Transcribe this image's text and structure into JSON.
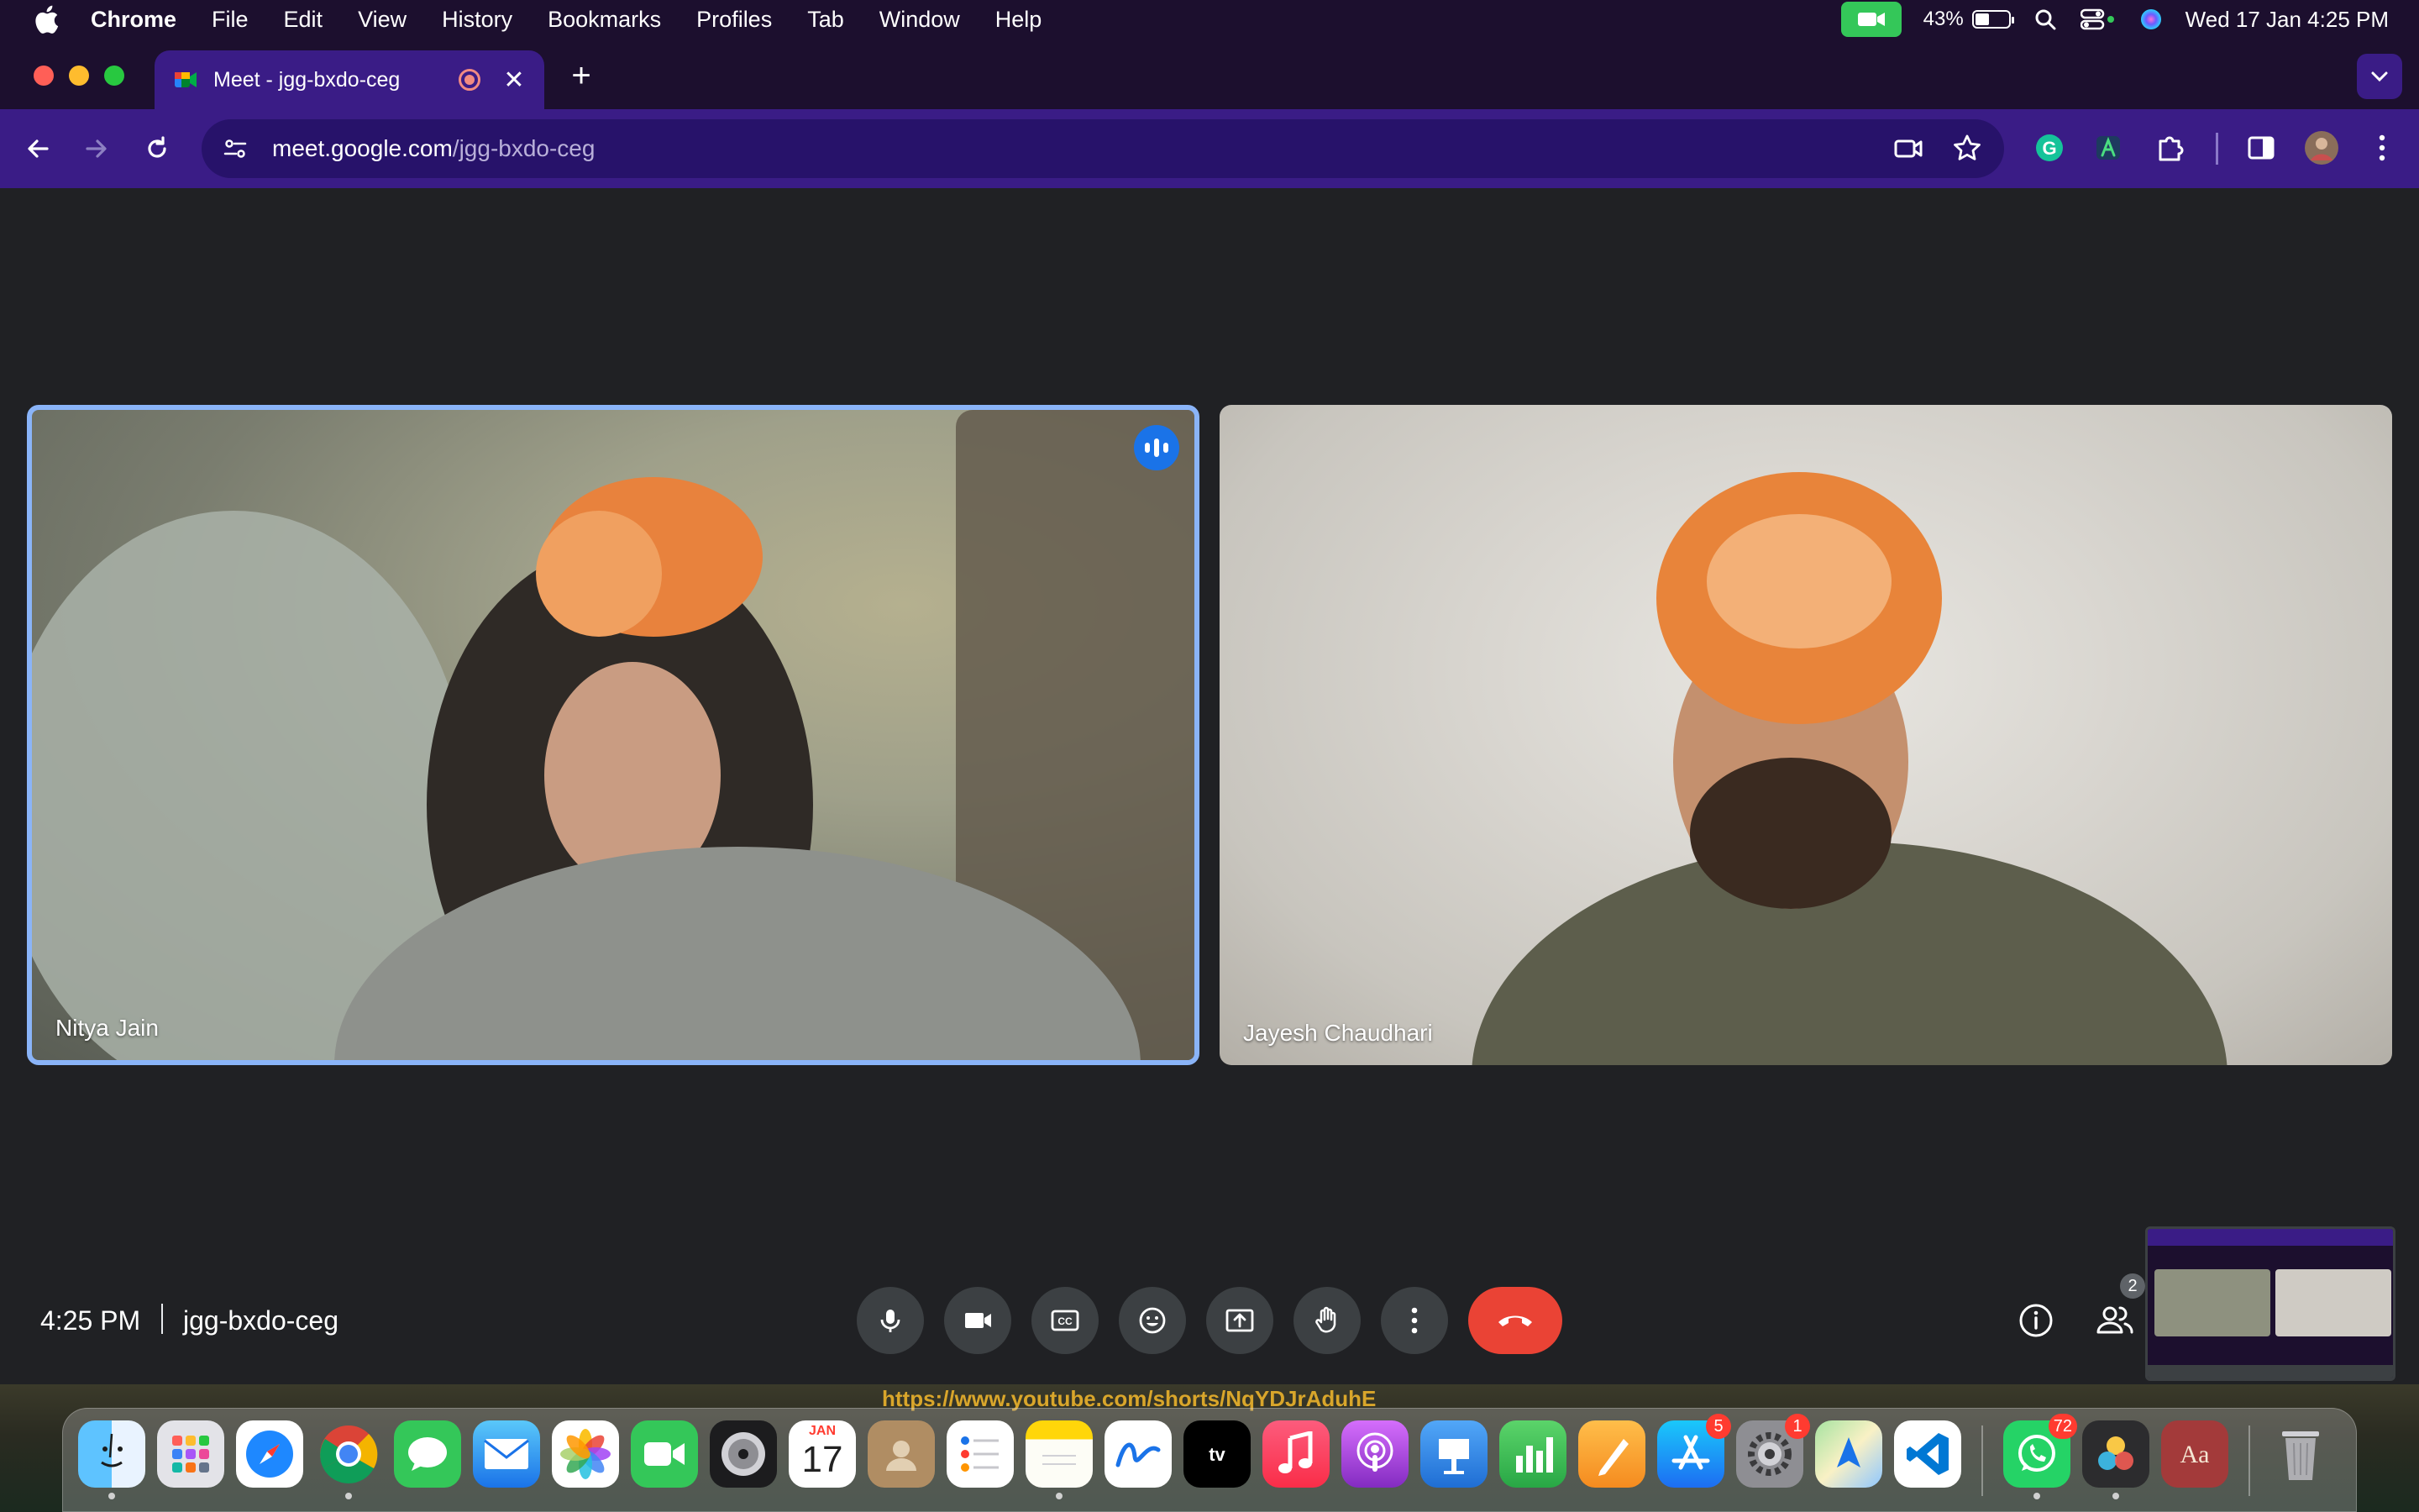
{
  "menubar": {
    "app": "Chrome",
    "items": [
      "File",
      "Edit",
      "View",
      "History",
      "Bookmarks",
      "Profiles",
      "Tab",
      "Window",
      "Help"
    ],
    "battery": "43%",
    "battery_level": 0.43,
    "clock": "Wed 17 Jan  4:25 PM"
  },
  "tab": {
    "title": "Meet - jgg-bxdo-ceg",
    "favicon": "google-meet-icon"
  },
  "toolbar": {
    "url_host": "meet.google.com",
    "url_path": "/jgg-bxdo-ceg"
  },
  "meet": {
    "participants": [
      {
        "name": "Nitya Jain",
        "speaking": true
      },
      {
        "name": "Jayesh Chaudhari",
        "speaking": false
      }
    ],
    "time": "4:25 PM",
    "meeting_code": "jgg-bxdo-ceg",
    "people_count": "2",
    "controls": [
      "mic-icon",
      "camera-icon",
      "captions-icon",
      "emoji-icon",
      "present-icon",
      "raise-hand-icon",
      "more-options-icon",
      "end-call-icon"
    ],
    "accent": "#8ab4f8",
    "end_call_color": "#ea4335"
  },
  "background": {
    "link_text": "https://www.youtube.com/shorts/NqYDJrAduhE"
  },
  "dock": {
    "calendar_month": "JAN",
    "calendar_day": "17",
    "badges": {
      "app_store": "5",
      "system_settings": "1",
      "whatsapp": "72"
    },
    "apps": [
      "finder",
      "launchpad",
      "safari",
      "chrome",
      "messages",
      "mail",
      "photos",
      "facetime",
      "logic",
      "calendar",
      "contacts",
      "reminders",
      "notes",
      "freeform",
      "apple-tv",
      "music",
      "podcasts",
      "keynote",
      "numbers",
      "pages",
      "app-store",
      "system-settings",
      "maps",
      "vscode",
      "whatsapp",
      "davinci",
      "dictionary",
      "trash"
    ]
  }
}
